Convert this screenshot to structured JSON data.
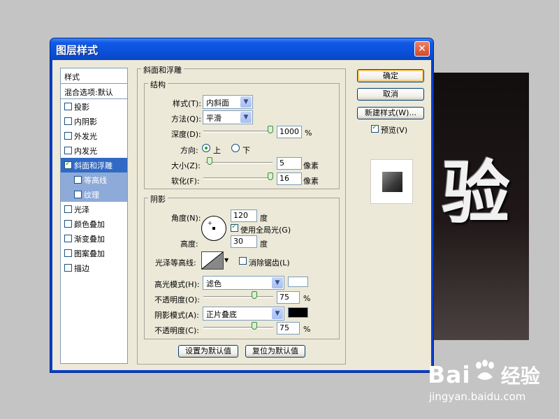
{
  "dialog": {
    "title": "图层样式",
    "close_icon": "close-icon"
  },
  "style_list": {
    "header": "样式",
    "blend_options": "混合选项:默认",
    "items": [
      {
        "label": "投影",
        "checked": false
      },
      {
        "label": "内阴影",
        "checked": false
      },
      {
        "label": "外发光",
        "checked": false
      },
      {
        "label": "内发光",
        "checked": false
      },
      {
        "label": "斜面和浮雕",
        "checked": true,
        "selected": true
      },
      {
        "label": "等高线",
        "checked": false,
        "sub": true
      },
      {
        "label": "纹理",
        "checked": false,
        "sub": true
      },
      {
        "label": "光泽",
        "checked": false
      },
      {
        "label": "颜色叠加",
        "checked": false
      },
      {
        "label": "渐变叠加",
        "checked": false
      },
      {
        "label": "图案叠加",
        "checked": false
      },
      {
        "label": "描边",
        "checked": false
      }
    ]
  },
  "bevel": {
    "group_title": "斜面和浮雕",
    "structure_title": "结构",
    "style_label": "样式(T):",
    "style_value": "内斜面",
    "technique_label": "方法(Q):",
    "technique_value": "平滑",
    "depth_label": "深度(D):",
    "depth_value": "1000",
    "depth_unit": "%",
    "depth_level": 1.0,
    "direction_label": "方向:",
    "direction_up": "上",
    "direction_down": "下",
    "direction_selected": "up",
    "size_label": "大小(Z):",
    "size_value": "5",
    "size_unit": "像素",
    "size_level": 0.02,
    "soften_label": "软化(F):",
    "soften_value": "16",
    "soften_unit": "像素",
    "soften_level": 1.0
  },
  "shading": {
    "title": "阴影",
    "angle_label": "角度(N):",
    "angle_value": "120",
    "angle_unit": "度",
    "global_light_label": "使用全局光(G)",
    "global_light_checked": true,
    "altitude_label": "高度:",
    "altitude_value": "30",
    "altitude_unit": "度",
    "gloss_contour_label": "光泽等高线:",
    "anti_alias_label": "消除锯齿(L)",
    "anti_alias_checked": false,
    "highlight_mode_label": "高光模式(H):",
    "highlight_mode_value": "滤色",
    "highlight_color": "#ffffff",
    "highlight_opacity_label": "不透明度(O):",
    "highlight_opacity_value": "75",
    "highlight_opacity_unit": "%",
    "highlight_opacity_level": 0.75,
    "shadow_mode_label": "阴影模式(A):",
    "shadow_mode_value": "正片叠底",
    "shadow_color": "#000000",
    "shadow_opacity_label": "不透明度(C):",
    "shadow_opacity_value": "75",
    "shadow_opacity_unit": "%",
    "shadow_opacity_level": 0.75
  },
  "buttons": {
    "make_default": "设置为默认值",
    "reset_default": "复位为默认值",
    "ok": "确定",
    "cancel": "取消",
    "new_style": "新建样式(W)...",
    "preview_label": "预览(V)",
    "preview_checked": true
  },
  "canvas": {
    "glyph": "验"
  },
  "watermark": {
    "logo_left": "Bai",
    "logo_right": "经验",
    "url": "jingyan.baidu.com",
    "paw_icon": "paw-icon"
  }
}
